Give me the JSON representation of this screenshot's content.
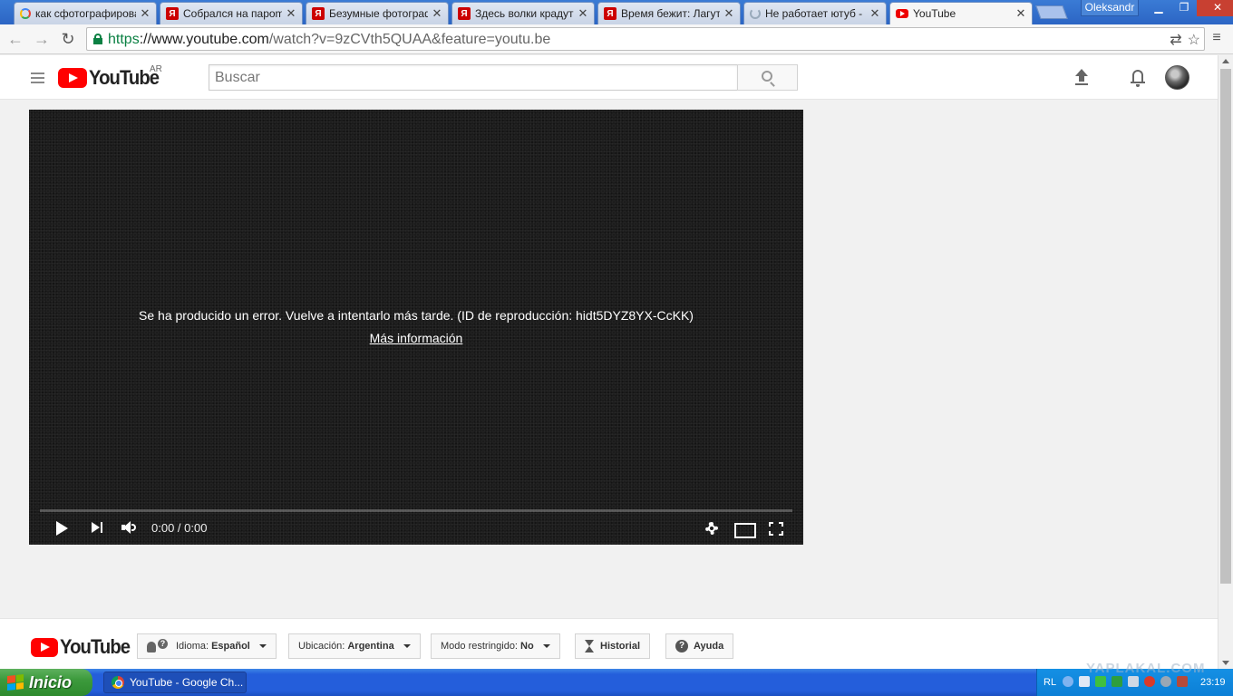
{
  "browser": {
    "tabs": [
      {
        "label": "как сфотографирова",
        "favicon": "google-icon"
      },
      {
        "label": "Собрался на пароm в",
        "favicon": "yaplakal-icon"
      },
      {
        "label": "Безумные фотограф",
        "favicon": "yaplakal-icon"
      },
      {
        "label": "Здесь волки крадут",
        "favicon": "yaplakal-icon"
      },
      {
        "label": "Время бежит: Лагуте",
        "favicon": "yaplakal-icon"
      },
      {
        "label": "Не работает ютуб -",
        "favicon": "loading-icon"
      },
      {
        "label": "YouTube",
        "favicon": "youtube-icon",
        "active": true
      }
    ],
    "profile_name": "Oleksandr",
    "url_scheme": "https",
    "url_host": "://www.youtube.com",
    "url_rest": "/watch?v=9zCVth5QUAA&feature=youtu.be"
  },
  "youtube": {
    "logo_text": "YouTube",
    "country_code": "AR",
    "search_placeholder": "Buscar",
    "player": {
      "error_message": "Se ha producido un error. Vuelve a intentarlo más tarde. (ID de reproducción: hidt5DYZ8YX-CcKK)",
      "more_info_link": "Más información",
      "time_display": "0:00 / 0:00",
      "progress": 0
    },
    "footer": {
      "logo_text": "YouTube",
      "language_label": "Idioma:",
      "language_value": "Español",
      "location_label": "Ubicación:",
      "location_value": "Argentina",
      "restricted_label": "Modo restringido:",
      "restricted_value": "No",
      "history_label": "Historial",
      "help_label": "Ayuda"
    }
  },
  "taskbar": {
    "start_label": "Inicio",
    "task_label": "YouTube - Google Ch...",
    "tray_lang": "RL",
    "clock": "23:19"
  },
  "watermark": "YAPLAKAL.COM"
}
